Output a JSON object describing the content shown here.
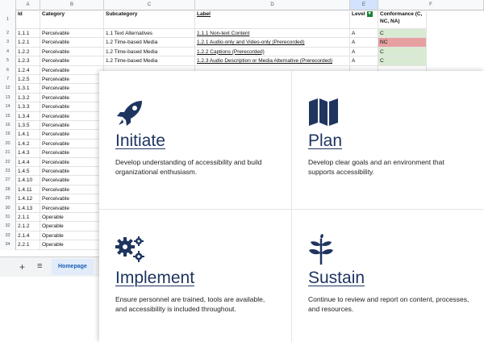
{
  "spreadsheet": {
    "columns": [
      "A",
      "B",
      "C",
      "D",
      "E",
      "F"
    ],
    "headers": {
      "id": "Id",
      "category": "Category",
      "subcategory": "Subcategory",
      "label": "Label",
      "level": "Level",
      "conformance": "Conformance (C, NC, NA)"
    },
    "row_numbers": [
      "1",
      "2",
      "3",
      "4",
      "5",
      "6",
      "7",
      "8",
      "9",
      "10",
      "11",
      "12",
      "13",
      "14",
      "15",
      "16",
      "17",
      "18",
      "19",
      "20",
      "21",
      "22",
      "23",
      "24",
      "25",
      "26",
      "27"
    ],
    "row_number_labels": [
      "1",
      "2",
      "3",
      "4",
      "5",
      "6",
      "7",
      "12",
      "13",
      "14",
      "15",
      "16",
      "17",
      "18",
      "19",
      "20",
      "21",
      "22",
      "23",
      "24",
      "25",
      "26",
      "27",
      "28",
      "29",
      "30",
      "31",
      "32",
      "33",
      "34",
      "35"
    ],
    "rows": [
      {
        "rn": "2",
        "id": "1.1.1",
        "category": "Perceivable",
        "subcategory": "1.1 Text Alternatives",
        "label": "1.1.1 Non-text Content",
        "level": "A",
        "conf": "C",
        "conf_color": "green"
      },
      {
        "rn": "3",
        "id": "1.2.1",
        "category": "Perceivable",
        "subcategory": "1.2 Time-based Media",
        "label": "1.2.1 Audio-only and Video-only (Prerecorded)",
        "level": "A",
        "conf": "NC",
        "conf_color": "red"
      },
      {
        "rn": "4",
        "id": "1.2.2",
        "category": "Perceivable",
        "subcategory": "1.2 Time-based Media",
        "label": "1.2.2 Captions (Prerecorded)",
        "level": "A",
        "conf": "C",
        "conf_color": "green"
      },
      {
        "rn": "5",
        "id": "1.2.3",
        "category": "Perceivable",
        "subcategory": "1.2 Time-based Media",
        "label": "1.2.3 Audio Description or Media Alternative (Prerecorded)",
        "level": "A",
        "conf": "C",
        "conf_color": "green"
      },
      {
        "rn": "6",
        "id": "1.2.4",
        "category": "Perceivable"
      },
      {
        "rn": "7",
        "id": "1.2.5",
        "category": "Perceivable"
      },
      {
        "rn": "12",
        "id": "1.3.1",
        "category": "Perceivable"
      },
      {
        "rn": "13",
        "id": "1.3.2",
        "category": "Perceivable"
      },
      {
        "rn": "14",
        "id": "1.3.3",
        "category": "Perceivable"
      },
      {
        "rn": "15",
        "id": "1.3.4",
        "category": "Perceivable"
      },
      {
        "rn": "16",
        "id": "1.3.5",
        "category": "Perceivable"
      },
      {
        "rn": "19",
        "id": "1.4.1",
        "category": "Perceivable"
      },
      {
        "rn": "20",
        "id": "1.4.2",
        "category": "Perceivable"
      },
      {
        "rn": "21",
        "id": "1.4.3",
        "category": "Perceivable"
      },
      {
        "rn": "22",
        "id": "1.4.4",
        "category": "Perceivable"
      },
      {
        "rn": "23",
        "id": "1.4.5",
        "category": "Perceivable"
      },
      {
        "rn": "27",
        "id": "1.4.10",
        "category": "Perceivable"
      },
      {
        "rn": "28",
        "id": "1.4.11",
        "category": "Perceivable"
      },
      {
        "rn": "29",
        "id": "1.4.12",
        "category": "Perceivable"
      },
      {
        "rn": "30",
        "id": "1.4.13",
        "category": "Perceivable"
      },
      {
        "rn": "31",
        "id": "2.1.1",
        "category": "Operable"
      },
      {
        "rn": "32",
        "id": "2.1.2",
        "category": "Operable"
      },
      {
        "rn": "33",
        "id": "2.1.4",
        "category": "Operable"
      },
      {
        "rn": "34",
        "id": "2.2.1",
        "category": "Operable"
      }
    ],
    "sheet_tab": "Homepage",
    "add_sheet_icon": "plus-icon",
    "all_sheets_icon": "list-icon"
  },
  "cards": [
    {
      "title": "Initiate",
      "icon": "rocket-icon",
      "description": "Develop understanding of accessibility and build organizational enthusiasm."
    },
    {
      "title": "Plan",
      "icon": "map-icon",
      "description": "Develop clear goals and an environment that supports accessibility."
    },
    {
      "title": "Implement",
      "icon": "gears-icon",
      "description": "Ensure personnel are trained, tools are available, and accessibility is included throughout."
    },
    {
      "title": "Sustain",
      "icon": "seedling-icon",
      "description": "Continue to review and report on content, processes, and resources."
    }
  ],
  "colors": {
    "accent": "#1f3560",
    "green": "#d9ead3",
    "red": "#e6a0a0",
    "selected": "#d3e3fd"
  }
}
